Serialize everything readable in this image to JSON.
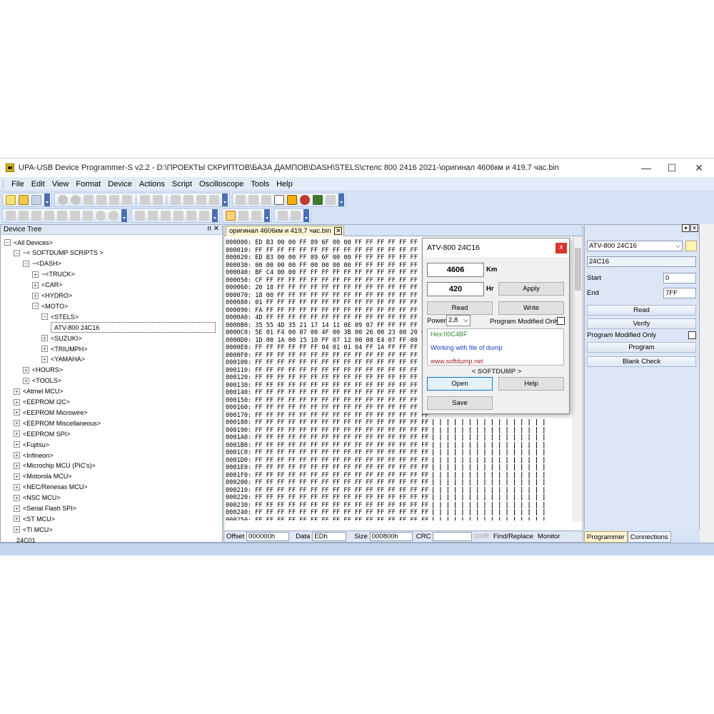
{
  "window": {
    "title": "UPA-USB Device Programmer-S v2.2 - D:\\ПРОЕКТЫ СКРИПТОВ\\БАЗА ДАМПОВ\\DASH\\STELS\\стелс 800 2416 2021-\\оригинал 4606км и 419,7 час.bin",
    "minimize": "—",
    "maximize": "☐",
    "close": "✕"
  },
  "menu": [
    "File",
    "Edit",
    "View",
    "Format",
    "Device",
    "Actions",
    "Script",
    "Oscilloscope",
    "Tools",
    "Help"
  ],
  "device_tree": {
    "header": "Device Tree",
    "pin": "ᴨ ✕",
    "nodes": [
      {
        "label": "<All Devices>",
        "level": 0,
        "pm": "−"
      },
      {
        "label": "~< SOFTDUMP SCRIPTS >",
        "level": 1,
        "pm": "−"
      },
      {
        "label": "~<DASH>",
        "level": 2,
        "pm": "−"
      },
      {
        "label": "~<TRUCK>",
        "level": 3,
        "pm": "+"
      },
      {
        "label": "<CAR>",
        "level": 3,
        "pm": "+"
      },
      {
        "label": "<HYDRO>",
        "level": 3,
        "pm": "+"
      },
      {
        "label": "<MOTO>",
        "level": 3,
        "pm": "−"
      },
      {
        "label": "<STELS>",
        "level": 4,
        "pm": "−"
      },
      {
        "label": "ATV-800 24C16",
        "level": 5,
        "pm": "",
        "selected": true
      },
      {
        "label": "<SUZUKI>",
        "level": 4,
        "pm": "+"
      },
      {
        "label": "<TRIUMPH>",
        "level": 4,
        "pm": "+"
      },
      {
        "label": "<YAMAHA>",
        "level": 4,
        "pm": "+"
      },
      {
        "label": "<HOURS>",
        "level": 2,
        "pm": "+"
      },
      {
        "label": "<TOOLS>",
        "level": 2,
        "pm": "+"
      },
      {
        "label": "<Atmel MCU>",
        "level": 1,
        "pm": "+"
      },
      {
        "label": "<EEPROM I2C>",
        "level": 1,
        "pm": "+"
      },
      {
        "label": "<EEPROM Microwire>",
        "level": 1,
        "pm": "+"
      },
      {
        "label": "<EEPROM Miscellaneous>",
        "level": 1,
        "pm": "+"
      },
      {
        "label": "<EEPROM SPI>",
        "level": 1,
        "pm": "+"
      },
      {
        "label": "<Fujitsu>",
        "level": 1,
        "pm": "+"
      },
      {
        "label": "<Infineon>",
        "level": 1,
        "pm": "+"
      },
      {
        "label": "<Microchip MCU (PIC's)>",
        "level": 1,
        "pm": "+"
      },
      {
        "label": "<Motorola MCU>",
        "level": 1,
        "pm": "+"
      },
      {
        "label": "<NEC/Renesas MCU>",
        "level": 1,
        "pm": "+"
      },
      {
        "label": "<NSC MCU>",
        "level": 1,
        "pm": "+"
      },
      {
        "label": "<Serial Flash SPI>",
        "level": 1,
        "pm": "+"
      },
      {
        "label": "<ST MCU>",
        "level": 1,
        "pm": "+"
      },
      {
        "label": "<TI MCU>",
        "level": 1,
        "pm": "+"
      },
      {
        "label": "24C01",
        "level": 1,
        "pm": ""
      }
    ]
  },
  "editor": {
    "tab": "оригинал 4606км и 419,7 час.bin",
    "tab_close": "✕",
    "hex_rows": [
      {
        "addr": "000000:",
        "bytes": "ED B3 00 00 FF 89 6F 00 00 FF FF FF FF FF FF FF"
      },
      {
        "addr": "000010:",
        "bytes": "FF FF FF FF FF FF FF FF FF FF FF FF FF FF FF FF"
      },
      {
        "addr": "000020:",
        "bytes": "ED B3 00 00 FF 89 6F 00 00 FF FF FF FF FF FF FF"
      },
      {
        "addr": "000030:",
        "bytes": "00 00 00 00 FF 00 00 00 00 FF FF FF FF FF FF FF"
      },
      {
        "addr": "000040:",
        "bytes": "BF C4 00 00 FF FF FF FF FF FF FF FF FF FF FF FF"
      },
      {
        "addr": "000050:",
        "bytes": "CF FF FF FF FF FF FF FF FF FF FF FF FF FF FF FF"
      },
      {
        "addr": "000060:",
        "bytes": "20 18 FF FF FF FF FF FF FF FF FF FF FF FF FF FF"
      },
      {
        "addr": "000070:",
        "bytes": "18 00 FF FF FF FF FF FF FF FF FF FF FF FF FF FF"
      },
      {
        "addr": "000080:",
        "bytes": "01 FF FF FF FF FF FF FF FF FF FF FF FF FF FF FF"
      },
      {
        "addr": "000090:",
        "bytes": "FA FF FF FF FF FF FF FF FF FF FF FF FF FF FF FF"
      },
      {
        "addr": "0000A0:",
        "bytes": "4D FF FF FF FF FF FF FF FF FF FF FF FF FF FF FF"
      },
      {
        "addr": "0000B0:",
        "bytes": "35 55 4D 35 21 17 14 11 0E 09 07 FF FF FF FF FF"
      },
      {
        "addr": "0000C0:",
        "bytes": "5E 01 F4 00 87 00 4F 00 3B 00 26 00 23 00 20 00"
      },
      {
        "addr": "0000D0:",
        "bytes": "1D 00 1A 00 15 10 FF 07 12 00 08 E4 07 FF 00 FF"
      },
      {
        "addr": "0000E0:",
        "bytes": "FF FF FF FF FF FF 04 01 01 04 FF 1A FF FF FF FF"
      },
      {
        "addr": "0000F0:",
        "bytes": "FF FF FF FF FF FF FF FF FF FF FF FF FF FF FF FF"
      },
      {
        "addr": "000100:",
        "bytes": "FF FF FF FF FF FF FF FF FF FF FF FF FF FF FF FF"
      },
      {
        "addr": "000110:",
        "bytes": "FF FF FF FF FF FF FF FF FF FF FF FF FF FF FF FF"
      },
      {
        "addr": "000120:",
        "bytes": "FF FF FF FF FF FF FF FF FF FF FF FF FF FF FF FF"
      },
      {
        "addr": "000130:",
        "bytes": "FF FF FF FF FF FF FF FF FF FF FF FF FF FF FF FF"
      },
      {
        "addr": "000140:",
        "bytes": "FF FF FF FF FF FF FF FF FF FF FF FF FF FF FF FF"
      },
      {
        "addr": "000150:",
        "bytes": "FF FF FF FF FF FF FF FF FF FF FF FF FF FF FF FF"
      },
      {
        "addr": "000160:",
        "bytes": "FF FF FF FF FF FF FF FF FF FF FF FF FF FF FF FF"
      },
      {
        "addr": "000170:",
        "bytes": "FF FF FF FF FF FF FF FF FF FF FF FF FF FF FF FF"
      },
      {
        "addr": "000180:",
        "bytes": "FF FF FF FF FF FF FF FF FF FF FF FF FF FF FF FF"
      },
      {
        "addr": "000190:",
        "bytes": "FF FF FF FF FF FF FF FF FF FF FF FF FF FF FF FF"
      },
      {
        "addr": "0001A0:",
        "bytes": "FF FF FF FF FF FF FF FF FF FF FF FF FF FF FF FF"
      },
      {
        "addr": "0001B0:",
        "bytes": "FF FF FF FF FF FF FF FF FF FF FF FF FF FF FF FF"
      },
      {
        "addr": "0001C0:",
        "bytes": "FF FF FF FF FF FF FF FF FF FF FF FF FF FF FF FF"
      },
      {
        "addr": "0001D0:",
        "bytes": "FF FF FF FF FF FF FF FF FF FF FF FF FF FF FF FF"
      },
      {
        "addr": "0001E0:",
        "bytes": "FF FF FF FF FF FF FF FF FF FF FF FF FF FF FF FF"
      },
      {
        "addr": "0001F0:",
        "bytes": "FF FF FF FF FF FF FF FF FF FF FF FF FF FF FF FF"
      },
      {
        "addr": "000200:",
        "bytes": "FF FF FF FF FF FF FF FF FF FF FF FF FF FF FF FF"
      },
      {
        "addr": "000210:",
        "bytes": "FF FF FF FF FF FF FF FF FF FF FF FF FF FF FF FF"
      },
      {
        "addr": "000220:",
        "bytes": "FF FF FF FF FF FF FF FF FF FF FF FF FF FF FF FF"
      },
      {
        "addr": "000230:",
        "bytes": "FF FF FF FF FF FF FF FF FF FF FF FF FF FF FF FF"
      },
      {
        "addr": "000240:",
        "bytes": "FF FF FF FF FF FF FF FF FF FF FF FF FF FF FF FF"
      },
      {
        "addr": "000250:",
        "bytes": "FF FF FF FF FF FF FF FF FF FF FF FF FF FF FF FF"
      }
    ],
    "ascii_col": "| | | | | | | | | | | | | | | |",
    "status": {
      "offset_label": "Offset",
      "offset_value": "000000h",
      "data_label": "Data",
      "data_value": "EDh",
      "size_label": "Size",
      "size_value": "000800h",
      "crc_label": "CRC",
      "crc_value": "",
      "ovr": "OVR",
      "find_replace": "Find/Replace",
      "monitor": "Monitor"
    }
  },
  "dialog": {
    "title": "ATV-800 24C16",
    "close": "x",
    "km_value": "4606",
    "km_unit": "Km",
    "hr_value": "420",
    "hr_unit": "Hr",
    "apply": "Apply",
    "read": "Read",
    "write": "Write",
    "power_label": "Power",
    "power_value": "2,8",
    "program_modified_only": "Program Modified Only",
    "hex_line": "Hex:00C4BF",
    "status_line": "Working with file of dump",
    "website": "www.softdump.net",
    "brand": "< SOFTDUMP >",
    "open": "Open",
    "help": "Help",
    "save": "Save"
  },
  "right_panel": {
    "device_combo": "ATV-800 24C16",
    "chip_field": "24C16",
    "start_label": "Start",
    "start_value": "0",
    "end_label": "End",
    "end_value": "7FF",
    "read": "Read",
    "verify": "Verify",
    "program_modified_only": "Program Modified Only",
    "program": "Program",
    "blank_check": "Blank Check",
    "tabs": [
      "Programmer",
      "Connections"
    ]
  },
  "colors": {
    "accent_blue": "#4a6fb5",
    "hex_green": "#2a8a2a",
    "status_blue": "#1a3cc4",
    "website_red": "#9b1c1c"
  }
}
